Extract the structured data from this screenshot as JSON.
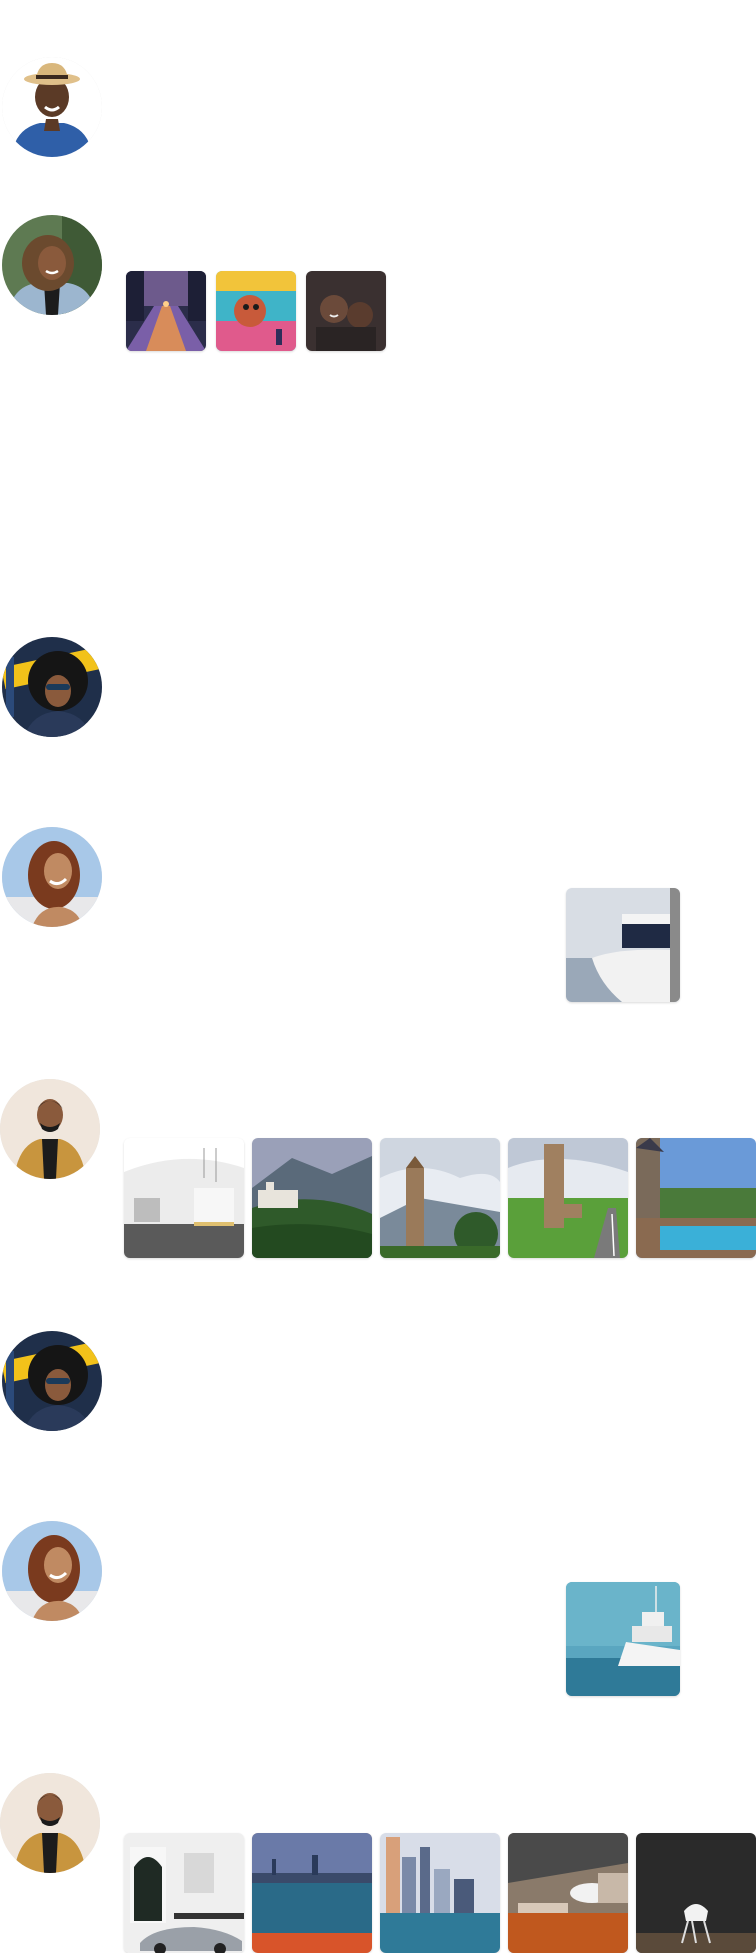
{
  "feed": {
    "posts": [
      {
        "avatar_icon": "avatar-man-straw-hat-icon",
        "images": []
      },
      {
        "avatar_icon": "avatar-woman-denim-jacket-icon",
        "images": [
          "city-street-night-image",
          "graffiti-wall-image",
          "couple-selfie-image"
        ]
      },
      {
        "avatar_icon": "avatar-woman-afro-sunglasses-icon",
        "images": []
      },
      {
        "avatar_icon": "avatar-woman-curly-hair-icon",
        "images": [
          "yacht-bow-image"
        ]
      },
      {
        "avatar_icon": "avatar-man-mustard-coat-icon",
        "images": [
          "white-interior-image",
          "mountain-castle-image",
          "stone-tower-image",
          "bell-tower-road-image",
          "pool-house-image"
        ]
      },
      {
        "avatar_icon": "avatar-woman-afro-sunglasses-icon",
        "images": []
      },
      {
        "avatar_icon": "avatar-woman-curly-hair-icon",
        "images": [
          "white-yacht-sea-image"
        ]
      },
      {
        "avatar_icon": "avatar-man-mustard-coat-icon",
        "images": [
          "townhouse-porsche-image",
          "city-skyline-water-image",
          "skyscrapers-harbor-image",
          "modern-bathroom-image",
          "white-chair-dark-wall-image"
        ]
      }
    ]
  },
  "colors": {
    "background": "#ffffff",
    "image_border_radius_hint": "rounded",
    "skin_dark": "#5b3a26",
    "skin_medium": "#8a5a3c",
    "denim": "#2f5fa8",
    "mustard": "#c8953e"
  }
}
